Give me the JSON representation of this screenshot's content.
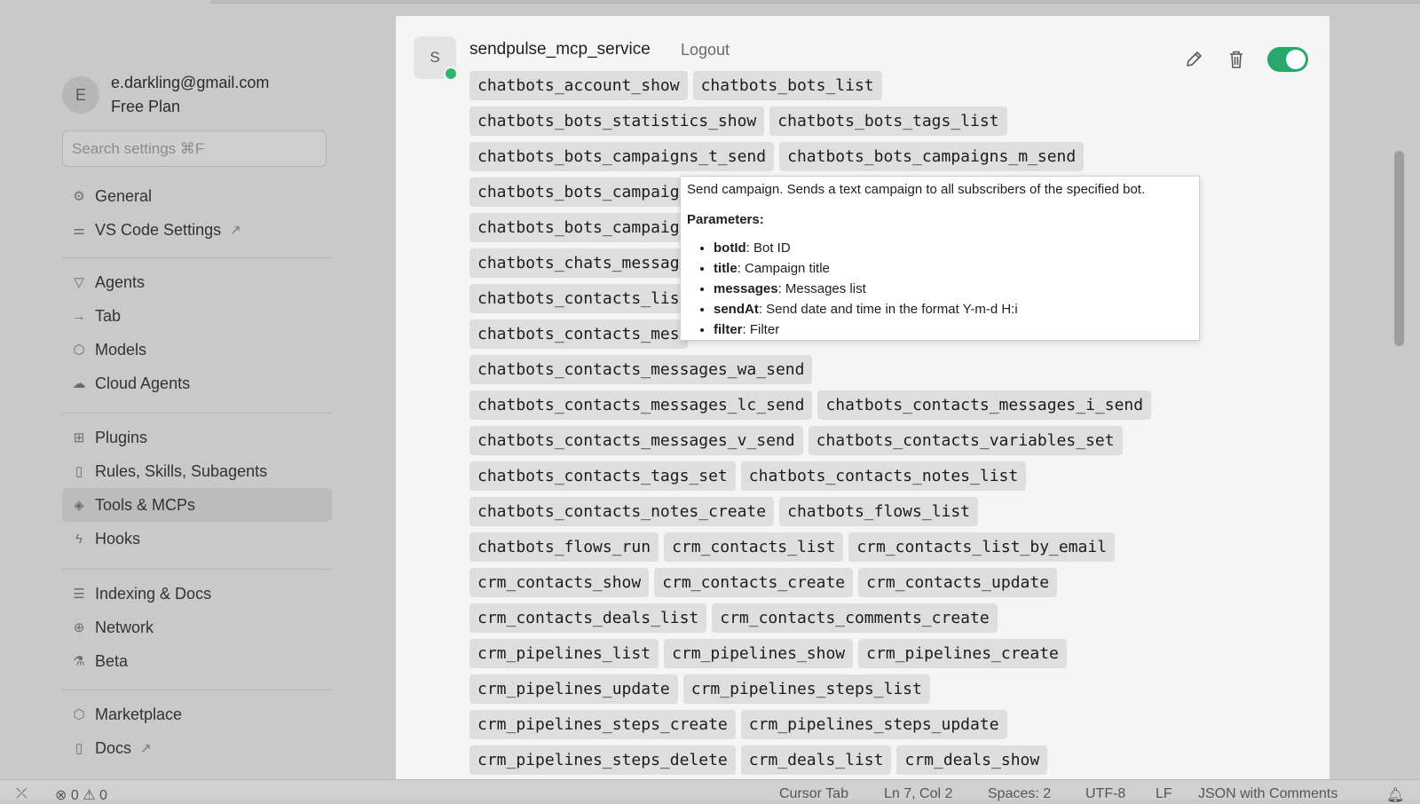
{
  "user": {
    "initial": "E",
    "email": "e.darkling@gmail.com",
    "plan": "Free Plan"
  },
  "search": {
    "placeholder": "Search settings ⌘F"
  },
  "nav_groups": [
    [
      {
        "label": "General",
        "icon": "gear-icon"
      },
      {
        "label": "VS Code Settings",
        "icon": "sliders-icon",
        "external": true
      }
    ],
    [
      {
        "label": "Agents",
        "icon": "agents-icon"
      },
      {
        "label": "Tab",
        "icon": "tab-icon"
      },
      {
        "label": "Models",
        "icon": "cube-icon"
      },
      {
        "label": "Cloud Agents",
        "icon": "cloud-icon"
      }
    ],
    [
      {
        "label": "Plugins",
        "icon": "plugins-icon"
      },
      {
        "label": "Rules, Skills, Subagents",
        "icon": "book-icon"
      },
      {
        "label": "Tools & MCPs",
        "icon": "tools-icon",
        "active": true
      },
      {
        "label": "Hooks",
        "icon": "bolt-icon"
      }
    ],
    [
      {
        "label": "Indexing & Docs",
        "icon": "database-icon"
      },
      {
        "label": "Network",
        "icon": "globe-icon"
      },
      {
        "label": "Beta",
        "icon": "flask-icon"
      }
    ],
    [
      {
        "label": "Marketplace",
        "icon": "cube-icon"
      },
      {
        "label": "Docs",
        "icon": "book-icon",
        "external": true
      }
    ]
  ],
  "server": {
    "initial": "S",
    "name": "sendpulse_mcp_service",
    "logout_label": "Logout",
    "enabled": true,
    "status_color": "#2eb56b"
  },
  "tool_rows": [
    [
      "chatbots_account_show",
      "chatbots_bots_list"
    ],
    [
      "chatbots_bots_statistics_show",
      "chatbots_bots_tags_list"
    ],
    [
      "chatbots_bots_campaigns_t_send",
      "chatbots_bots_campaigns_m_send"
    ],
    [
      "chatbots_bots_campaig"
    ],
    [
      "chatbots_bots_campaig"
    ],
    [
      "chatbots_chats_messag"
    ],
    [
      "chatbots_contacts_lis"
    ],
    [
      "chatbots_contacts_mes"
    ],
    [
      "chatbots_contacts_messages_wa_send"
    ],
    [
      "chatbots_contacts_messages_lc_send",
      "chatbots_contacts_messages_i_send"
    ],
    [
      "chatbots_contacts_messages_v_send",
      "chatbots_contacts_variables_set"
    ],
    [
      "chatbots_contacts_tags_set",
      "chatbots_contacts_notes_list"
    ],
    [
      "chatbots_contacts_notes_create",
      "chatbots_flows_list"
    ],
    [
      "chatbots_flows_run",
      "crm_contacts_list",
      "crm_contacts_list_by_email"
    ],
    [
      "crm_contacts_show",
      "crm_contacts_create",
      "crm_contacts_update"
    ],
    [
      "crm_contacts_deals_list",
      "crm_contacts_comments_create"
    ],
    [
      "crm_pipelines_list",
      "crm_pipelines_show",
      "crm_pipelines_create"
    ],
    [
      "crm_pipelines_update",
      "crm_pipelines_steps_list"
    ],
    [
      "crm_pipelines_steps_create",
      "crm_pipelines_steps_update"
    ],
    [
      "crm_pipelines_steps_delete",
      "crm_deals_list",
      "crm_deals_show"
    ]
  ],
  "tooltip": {
    "description": "Send campaign. Sends a text campaign to all subscribers of the specified bot.",
    "params_heading": "Parameters:",
    "params": [
      {
        "name": "botId",
        "desc": ": Bot ID"
      },
      {
        "name": "title",
        "desc": ": Campaign title"
      },
      {
        "name": "messages",
        "desc": ": Messages list"
      },
      {
        "name": "sendAt",
        "desc": ": Send date and time in the format Y-m-d H:i"
      },
      {
        "name": "filter",
        "desc": ": Filter"
      }
    ]
  },
  "status_bar": {
    "errors": "0",
    "warnings": "0",
    "items": [
      "Cursor Tab",
      "Ln 7, Col 2",
      "Spaces: 2",
      "UTF-8",
      "LF",
      "JSON with Comments"
    ]
  }
}
